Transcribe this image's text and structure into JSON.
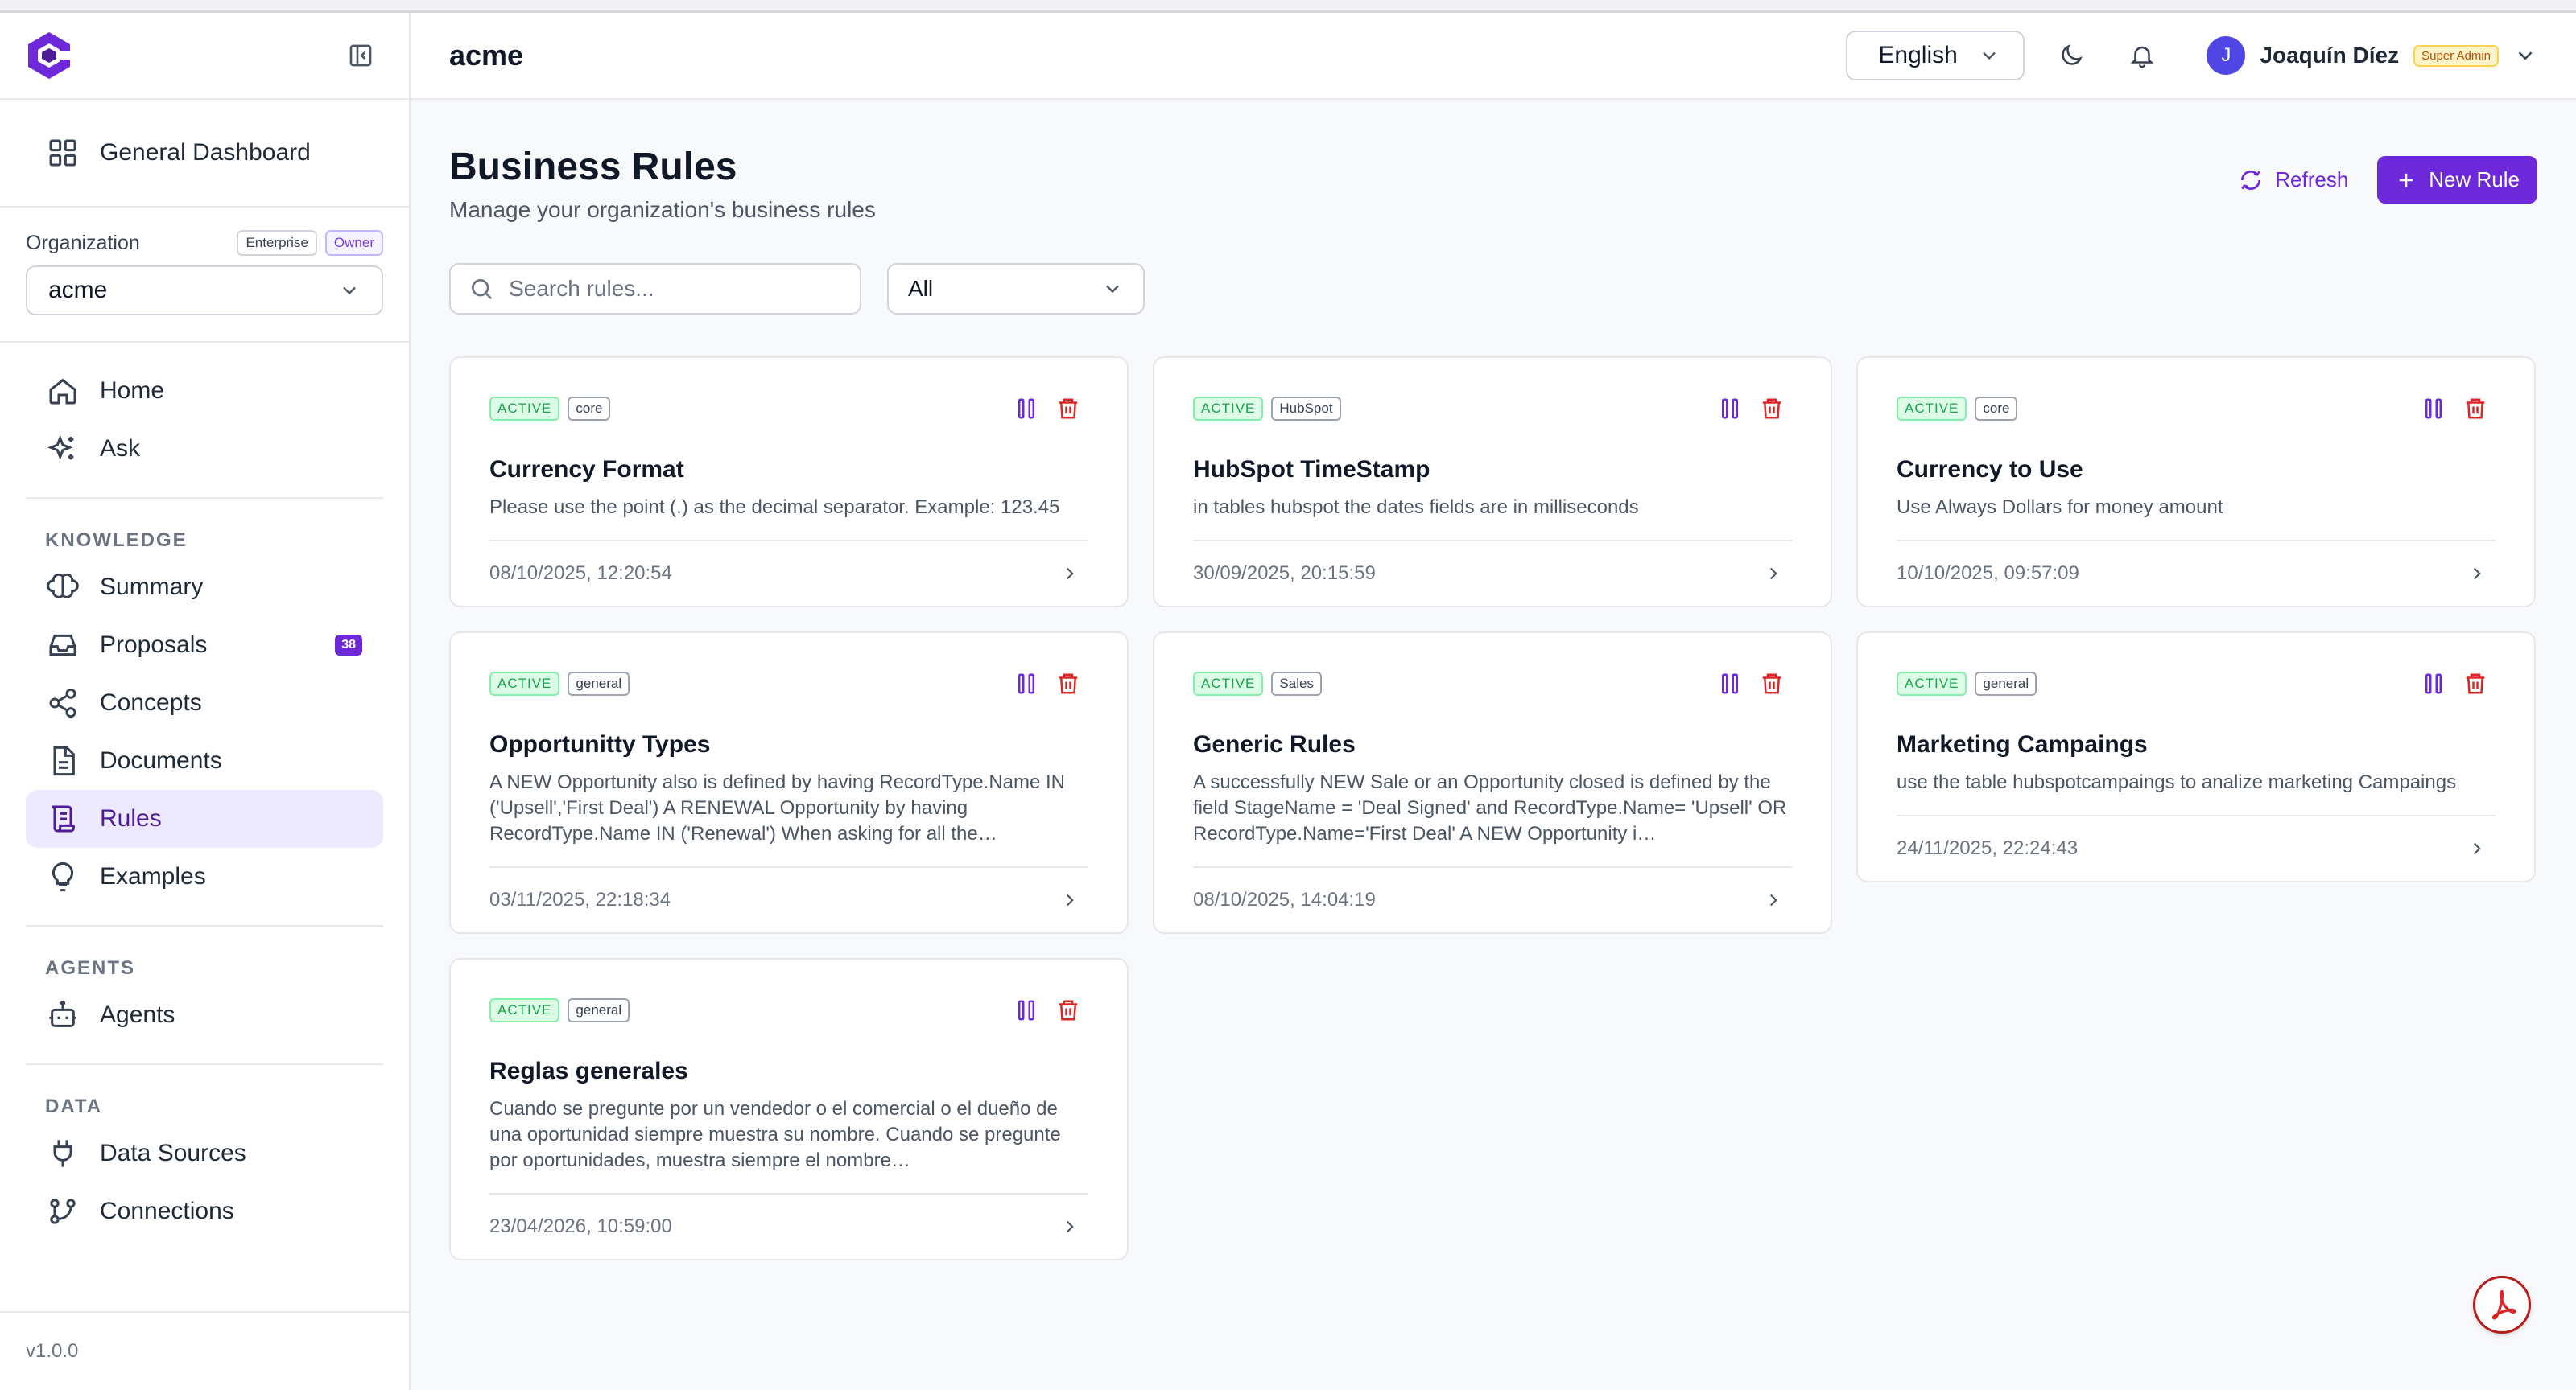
{
  "header": {
    "title": "acme",
    "language": "English",
    "user_initial": "J",
    "user_name": "Joaquín Díez",
    "user_role": "Super Admin"
  },
  "sidebar": {
    "general_dashboard": "General Dashboard",
    "organization": {
      "title": "Organization",
      "badge_plan": "Enterprise",
      "badge_role": "Owner",
      "selected": "acme"
    },
    "main_items": [
      {
        "label": "Home",
        "icon": "home-icon"
      },
      {
        "label": "Ask",
        "icon": "sparkles-icon"
      }
    ],
    "knowledge": {
      "title": "KNOWLEDGE",
      "items": [
        {
          "label": "Summary",
          "icon": "brain-icon"
        },
        {
          "label": "Proposals",
          "icon": "inbox-icon",
          "count": "38"
        },
        {
          "label": "Concepts",
          "icon": "share-icon"
        },
        {
          "label": "Documents",
          "icon": "document-icon"
        },
        {
          "label": "Rules",
          "icon": "scroll-icon",
          "active": true
        },
        {
          "label": "Examples",
          "icon": "lightbulb-icon"
        }
      ]
    },
    "agents": {
      "title": "AGENTS",
      "items": [
        {
          "label": "Agents",
          "icon": "bot-icon"
        }
      ]
    },
    "data": {
      "title": "DATA",
      "items": [
        {
          "label": "Data Sources",
          "icon": "plug-icon"
        },
        {
          "label": "Connections",
          "icon": "git-branch-icon"
        }
      ]
    },
    "version": "v1.0.0"
  },
  "main": {
    "title": "Business Rules",
    "subtitle": "Manage your organization's business rules",
    "refresh_label": "Refresh",
    "new_rule_label": "New Rule",
    "search_placeholder": "Search rules...",
    "filter_value": "All"
  },
  "rules": [
    {
      "status": "ACTIVE",
      "category": "core",
      "title": "Currency Format",
      "description": "Please use the point (.) as the decimal separator. Example: 123.45",
      "date": "08/10/2025, 12:20:54"
    },
    {
      "status": "ACTIVE",
      "category": "HubSpot",
      "title": "HubSpot TimeStamp",
      "description": "in tables hubspot the dates fields are in milliseconds",
      "date": "30/09/2025, 20:15:59"
    },
    {
      "status": "ACTIVE",
      "category": "core",
      "title": "Currency to Use",
      "description": "Use Always Dollars for money amount",
      "date": "10/10/2025, 09:57:09"
    },
    {
      "status": "ACTIVE",
      "category": "general",
      "title": "Opportunitty Types",
      "description": "A NEW Opportunity also is defined by having RecordType.Name IN ('Upsell','First Deal') A RENEWAL Opportunity by having RecordType.Name IN ('Renewal') When asking for all the…",
      "date": "03/11/2025, 22:18:34"
    },
    {
      "status": "ACTIVE",
      "category": "Sales",
      "title": "Generic Rules",
      "description": "A successfully NEW Sale or an Opportunity closed is defined by the field StageName = 'Deal Signed' and RecordType.Name= 'Upsell' OR RecordType.Name='First Deal' A NEW Opportunity i…",
      "date": "08/10/2025, 14:04:19"
    },
    {
      "status": "ACTIVE",
      "category": "general",
      "title": "Marketing Campaings",
      "description": "use the table hubspotcampaings to analize marketing Campaings",
      "date": "24/11/2025, 22:24:43"
    },
    {
      "status": "ACTIVE",
      "category": "general",
      "title": "Reglas generales",
      "description": "Cuando se pregunte por un vendedor o el comercial o el dueño de una oportunidad siempre muestra su nombre. Cuando se pregunte por oportunidades, muestra siempre el nombre…",
      "date": "23/04/2026, 10:59:00"
    }
  ],
  "colors": {
    "accent": "#6d28d9",
    "active_green": "#16a34a",
    "delete_red": "#dc2626"
  }
}
